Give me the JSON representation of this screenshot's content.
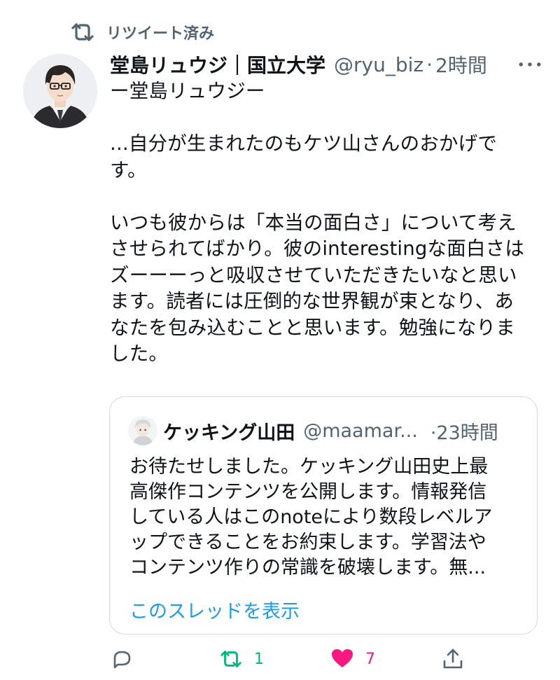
{
  "retweet_banner": {
    "label": "リツイート済み"
  },
  "tweet": {
    "author_name": "堂島リュウジ｜国立大学",
    "author_handle": "@ryu_biz",
    "separator": "·",
    "time": "2時間",
    "text": "ー堂島リュウジー\n\n...自分が生まれたのもケツ山さんのおかげで\nす。\n\nいつも彼からは「本当の面白さ」について考え\nさせられてばかり。彼のinterestingな面白さは\nズーーーっと吸収させていただきたいなと思い\nます。読者には圧倒的な世界観が束となり、あ\nなたを包み込むことと思います。勉強になりま\nした。"
  },
  "quote": {
    "author_name": "ケッキング山田",
    "author_handle": "@maamar...",
    "time": "·23時間",
    "text": "お待たせしました。ケッキング山田史上最\n高傑作コンテンツを公開します。情報発信\nしている人はこのnoteにより数段レベルア\nップできることをお約束します。学習法や\nコンテンツ作りの常識を破壊します。無...",
    "show_thread": "このスレッドを表示"
  },
  "actions": {
    "reply_count": "",
    "retweet_count": "1",
    "like_count": "7"
  },
  "colors": {
    "text": "#0f1419",
    "muted": "#536471",
    "link": "#1d9bf0",
    "retweet_green": "#00ba7c",
    "like_pink": "#f91880",
    "border": "#cfd9de"
  },
  "icons": {
    "retweet_banner": "retweet-icon",
    "more": "more-dots-icon",
    "reply": "reply-icon",
    "retweet": "retweet-icon",
    "like": "heart-icon",
    "share": "share-icon"
  }
}
